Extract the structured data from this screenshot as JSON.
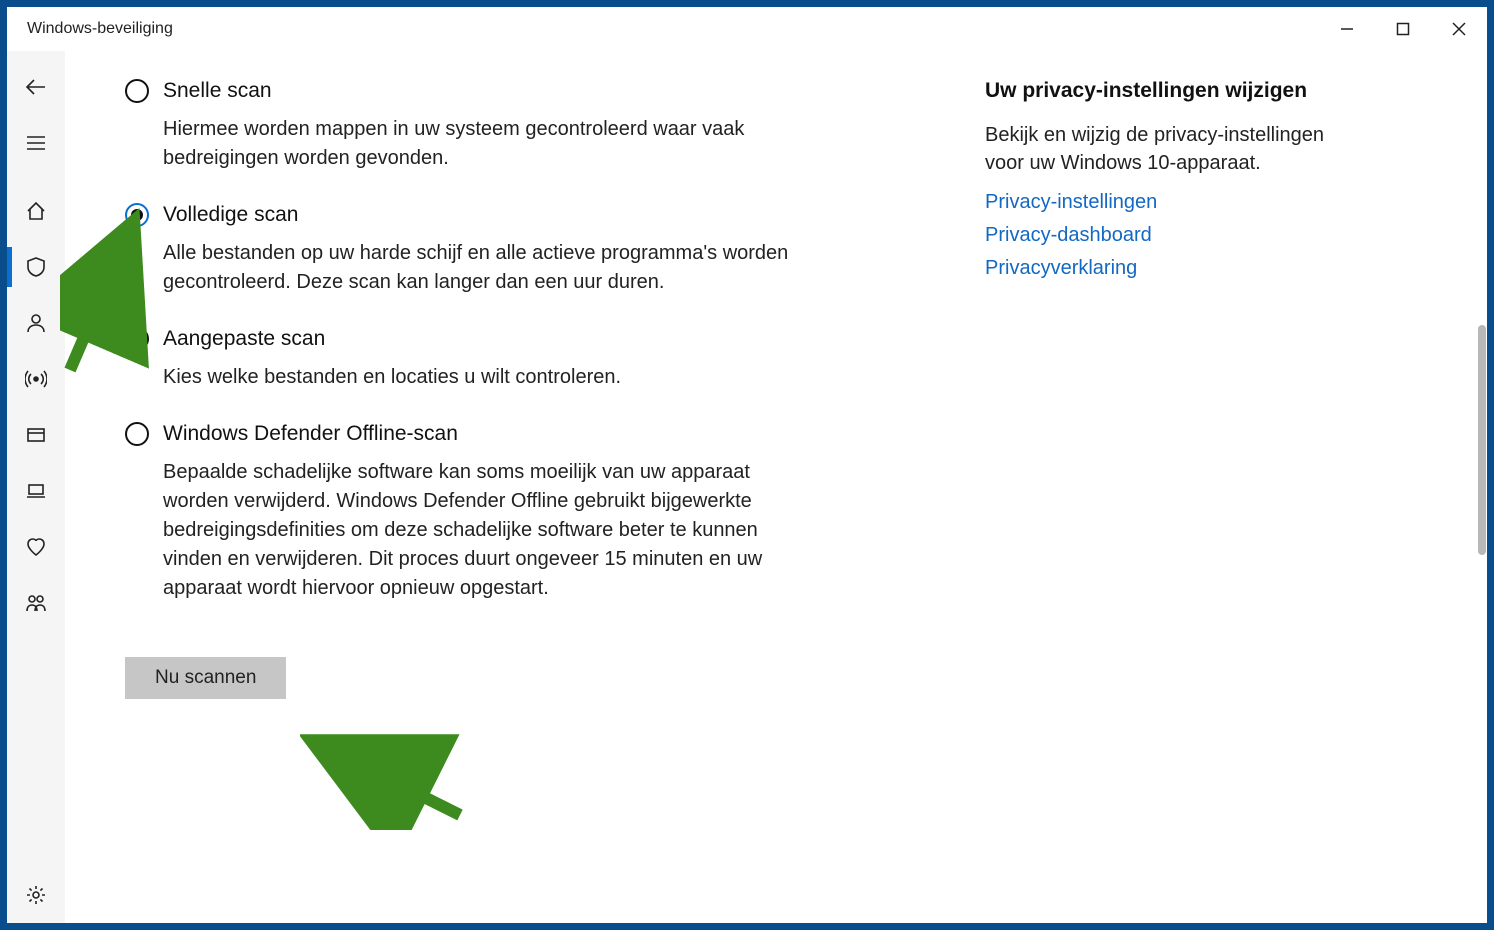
{
  "window": {
    "title": "Windows-beveiliging"
  },
  "options": [
    {
      "key": "quick",
      "label": "Snelle scan",
      "desc": "Hiermee worden mappen in uw systeem gecontroleerd waar vaak bedreigingen worden gevonden.",
      "selected": false
    },
    {
      "key": "full",
      "label": "Volledige scan",
      "desc": "Alle bestanden op uw harde schijf en alle actieve programma's worden gecontroleerd. Deze scan kan langer dan een uur duren.",
      "selected": true
    },
    {
      "key": "custom",
      "label": "Aangepaste scan",
      "desc": "Kies welke bestanden en locaties u wilt controleren.",
      "selected": false
    },
    {
      "key": "offline",
      "label": "Windows Defender Offline-scan",
      "desc": "Bepaalde schadelijke software kan soms moeilijk van uw apparaat worden verwijderd. Windows Defender Offline gebruikt bijgewerkte bedreigingsdefinities om deze schadelijke software beter te kunnen vinden en verwijderen. Dit proces duurt ongeveer 15 minuten en uw apparaat wordt hiervoor opnieuw opgestart.",
      "selected": false
    }
  ],
  "scan_button": "Nu scannen",
  "aside": {
    "heading": "Uw privacy-instellingen wijzigen",
    "text": "Bekijk en wijzig de privacy-instellingen voor uw Windows 10-apparaat.",
    "links": [
      "Privacy-instellingen",
      "Privacy-dashboard",
      "Privacyverklaring"
    ]
  }
}
